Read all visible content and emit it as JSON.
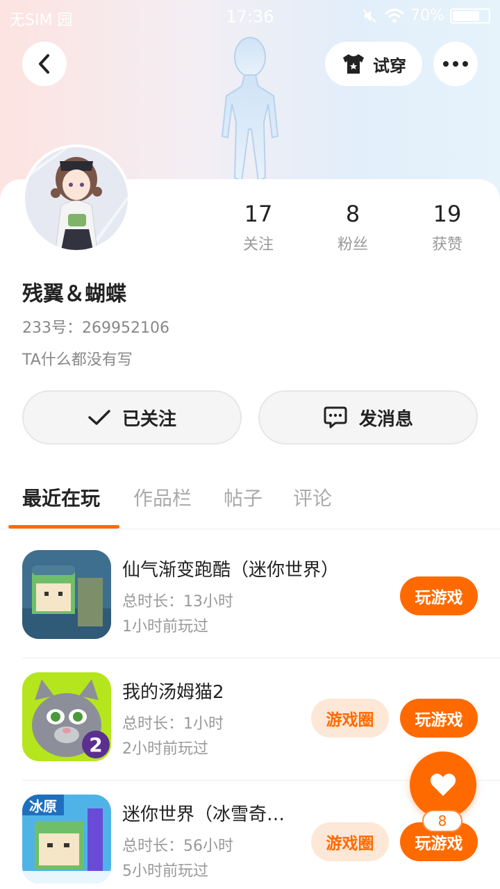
{
  "statusbar": {
    "carrier": "无SIM 园",
    "time": "17:36",
    "battery": "70%"
  },
  "header": {
    "tryon_label": "试穿"
  },
  "profile": {
    "stats": [
      {
        "value": "17",
        "label": "关注"
      },
      {
        "value": "8",
        "label": "粉丝"
      },
      {
        "value": "19",
        "label": "获赞"
      }
    ],
    "nickname": "残翼＆蝴蝶",
    "uid": "233号：269952106",
    "bio": "TA什么都没有写"
  },
  "actions": {
    "follow_label": "已关注",
    "message_label": "发消息"
  },
  "tabs": [
    "最近在玩",
    "作品栏",
    "帖子",
    "评论"
  ],
  "games": [
    {
      "title": "仙气渐变跑酷（迷你世界）",
      "duration": "总时长：13小时",
      "last_played": "1小时前玩过",
      "play_label": "玩游戏"
    },
    {
      "title": "我的汤姆猫2",
      "duration": "总时长：1小时",
      "last_played": "2小时前玩过",
      "circle_label": "游戏圈",
      "play_label": "玩游戏"
    },
    {
      "title": "迷你世界（冰雪奇…",
      "duration": "总时长：56小时",
      "last_played": "5小时前玩过",
      "circle_label": "游戏圈",
      "play_label": "玩游戏"
    }
  ],
  "fab": {
    "badge": "8"
  },
  "colors": {
    "accent": "#ff6a00",
    "accent_light": "#fde7d6"
  }
}
